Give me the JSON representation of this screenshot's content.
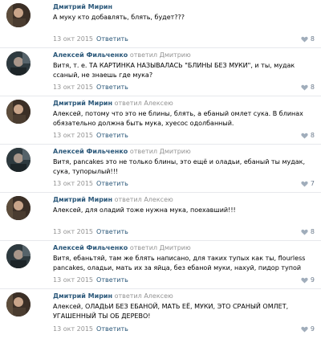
{
  "icons": {
    "like": "heart-icon"
  },
  "colors": {
    "author_link": "#2b587a",
    "meta_gray": "#939393",
    "divider": "#e7e8ec",
    "like_gray": "#6b7a8c"
  },
  "replied_label": "ответил",
  "reply_label": "Ответить",
  "comments": [
    {
      "author": "Дмитрий Мирин",
      "replied_to": "",
      "text": "А муку кто добавлять, блять, будет???",
      "date": "13 окт 2015",
      "likes": "8"
    },
    {
      "author": "Алексей Фильченко",
      "replied_to": "Дмитрию",
      "text": "Витя, т. е. ТА КАРТИНКА НАЗЫВАЛАСЬ \"БЛИНЫ БЕЗ МУКИ\", и ты, мудак ссаный, не знаешь где мука?",
      "date": "13 окт 2015",
      "likes": "8"
    },
    {
      "author": "Дмитрий Мирин",
      "replied_to": "Алексею",
      "text": "Алексей, потому что это не блины, блять, а ебаный омлет сука. В блинах обязательно должна быть мука, хуесос одолбанный.",
      "date": "13 окт 2015",
      "likes": "8"
    },
    {
      "author": "Алексей Фильченко",
      "replied_to": "Дмитрию",
      "text": "Витя, pancakes это не только блины, это ещё и оладьи, ебаный ты мудак, сука, тупорылый!!!",
      "date": "13 окт 2015",
      "likes": "7"
    },
    {
      "author": "Дмитрий Мирин",
      "replied_to": "Алексею",
      "text": "Алексей, для оладий тоже нужна мука, поехавший!!!",
      "date": "13 окт 2015",
      "likes": "8"
    },
    {
      "author": "Алексей Фильченко",
      "replied_to": "Дмитрию",
      "text": "Витя, ебаньтяй, там же блять написано, для таких тупых как ты, flourless pancakes, оладьи, мать их за яйца, без ебаной муки, нахуй, пидор тупой",
      "date": "13 окт 2015",
      "likes": "9"
    },
    {
      "author": "Дмитрий Мирин",
      "replied_to": "Алексею",
      "text": "Алексей, ОЛАДЬИ БЕЗ ЕБАНОЙ, МАТЬ ЕЁ, МУКИ, ЭТО СРАНЫЙ ОМЛЕТ, УГАШЕННЫЙ ТЫ ОБ ДЕРЕВО!",
      "date": "13 окт 2015",
      "likes": "9"
    }
  ]
}
